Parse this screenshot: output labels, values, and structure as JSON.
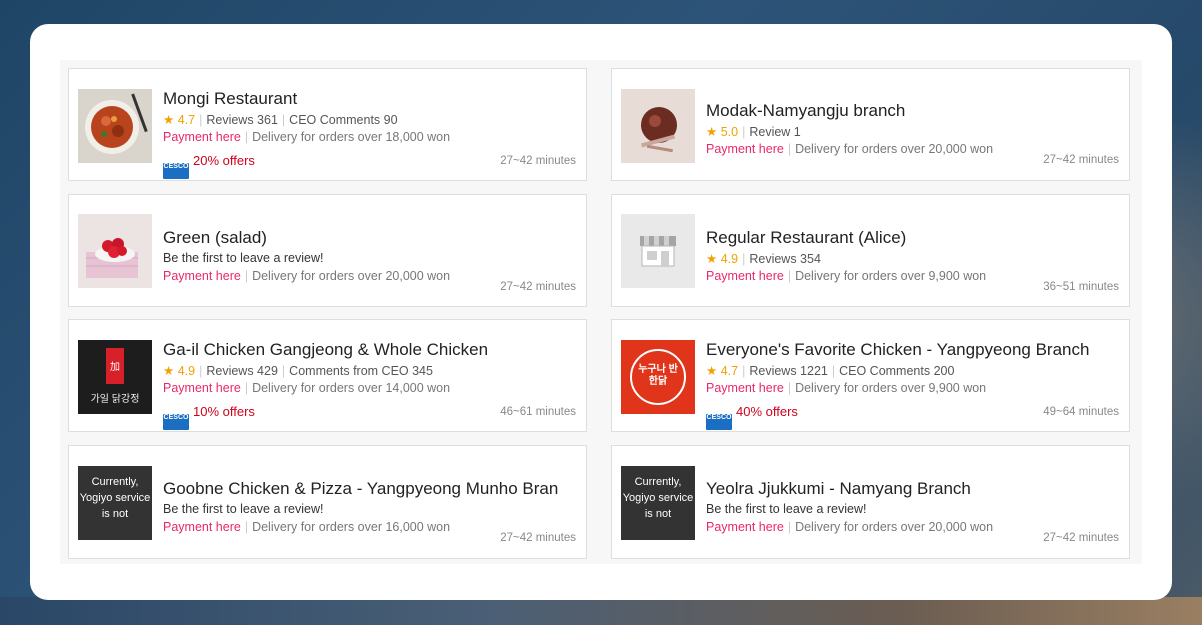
{
  "restaurants": [
    {
      "name": "Mongi Restaurant",
      "star": "★",
      "rating": "4.7",
      "reviews": "Reviews 361",
      "ceo": "CEO Comments 90",
      "payment": "Payment here",
      "delivery": "Delivery for orders over 18,000 won",
      "offer": "20% offers",
      "offer_logo": "CESCO",
      "time": "27~42 minutes",
      "thumb": "food-photo"
    },
    {
      "name": "Modak-Namyangju branch",
      "star": "★",
      "rating": "5.0",
      "reviews": "Review 1",
      "payment": "Payment here",
      "delivery": "Delivery for orders over 20,000 won",
      "time": "27~42 minutes",
      "thumb": "food-photo"
    },
    {
      "name": "Green (salad)",
      "first": "Be the first to leave a review!",
      "payment": "Payment here",
      "delivery": "Delivery for orders over 20,000 won",
      "time": "27~42 minutes",
      "thumb": "food-photo"
    },
    {
      "name": "Regular Restaurant (Alice)",
      "star": "★",
      "rating": "4.9",
      "reviews": "Reviews 354",
      "payment": "Payment here",
      "delivery": "Delivery for orders over 9,900 won",
      "time": "36~51 minutes",
      "thumb": "store-icon"
    },
    {
      "name": "Ga-il Chicken Gangjeong & Whole Chicken",
      "star": "★",
      "rating": "4.9",
      "reviews": "Reviews 429",
      "ceo": "Comments from CEO 345",
      "payment": "Payment here",
      "delivery": "Delivery for orders over 14,000 won",
      "offer": "10% offers",
      "offer_logo": "CESCO",
      "time": "46~61 minutes",
      "thumb": "logo",
      "logo_text": "가일 닭강정"
    },
    {
      "name": "Everyone's Favorite Chicken - Yangpyeong Branch",
      "star": "★",
      "rating": "4.7",
      "reviews": "Reviews 1221",
      "ceo": "CEO Comments 200",
      "payment": "Payment here",
      "delivery": "Delivery for orders over 9,900 won",
      "offer": "40% offers",
      "offer_logo": "CESCO",
      "time": "49~64 minutes",
      "thumb": "logo",
      "logo_text": "누구나 반한닭"
    },
    {
      "name": "Goobne Chicken & Pizza - Yangpyeong Munho Bran",
      "first": "Be the first to leave a review!",
      "payment": "Payment here",
      "delivery": "Delivery for orders over 16,000 won",
      "time": "27~42 minutes",
      "thumb": "notice",
      "notice": "Currently, Yogiyo service is not"
    },
    {
      "name": "Yeolra Jjukkumi - Namyang Branch",
      "first": "Be the first to leave a review!",
      "payment": "Payment here",
      "delivery": "Delivery for orders over 20,000 won",
      "time": "27~42 minutes",
      "thumb": "notice",
      "notice": "Currently, Yogiyo service is not"
    }
  ],
  "colors": {
    "rating": "#f4a000",
    "payment": "#e8286b",
    "offer": "#d0021b",
    "cesco": "#1a6fc2"
  }
}
